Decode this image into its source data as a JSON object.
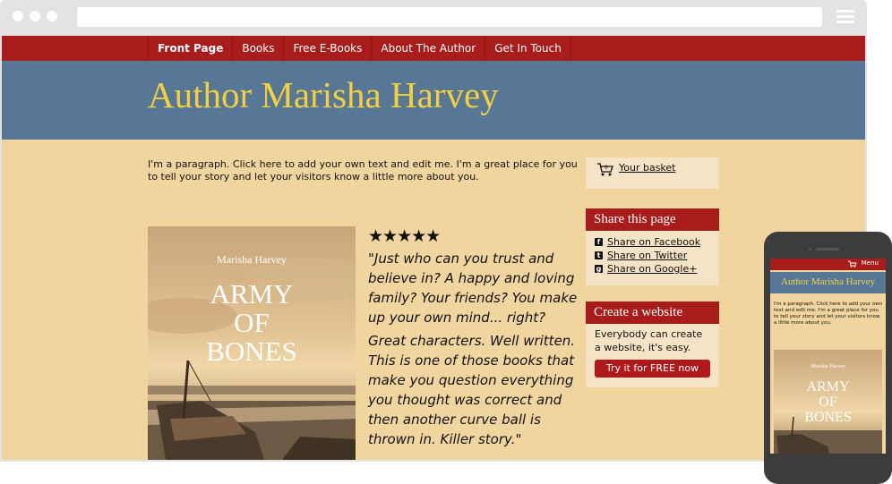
{
  "browser": {
    "url": ""
  },
  "nav": {
    "items": [
      {
        "label": "Front Page",
        "active": true
      },
      {
        "label": "Books"
      },
      {
        "label": "Free E-Books"
      },
      {
        "label": "About The Author"
      },
      {
        "label": "Get In Touch"
      }
    ]
  },
  "header": {
    "title": "Author Marisha Harvey"
  },
  "intro": {
    "text": "I'm a paragraph. Click here to add your own text and edit me. I'm a great place for you to tell your story and let your visitors know a little more about you."
  },
  "book": {
    "author": "Marisha Harvey",
    "title_lines": [
      "ARMY",
      "OF",
      "BONES"
    ]
  },
  "review": {
    "stars": "★★★★★",
    "rating": 5,
    "quote_1": "\"Just who can you trust and believe in? A happy and loving family? Your friends? You make up your own mind... right?",
    "quote_2": "Great characters. Well written. This is one of those books that make you question everything you thought was correct and then another curve ball is thrown in. Killer story.\""
  },
  "basket": {
    "label": "Your basket",
    "count": "0"
  },
  "share": {
    "heading": "Share this page",
    "items": [
      {
        "label": "Share on Facebook",
        "icon": "facebook-icon"
      },
      {
        "label": "Share on Twitter",
        "icon": "twitter-icon"
      },
      {
        "label": "Share on Google+",
        "icon": "google-plus-icon"
      }
    ]
  },
  "create": {
    "heading": "Create a website",
    "text": "Everybody can create a website, it's easy.",
    "button": "Try it for FREE now"
  },
  "mobile": {
    "menu": "Menu",
    "title": "Author Marisha Harvey",
    "text": "I'm a paragraph. Click here to add your own text and edit me. I'm a great place for you to tell your story and let your visitors know a little more about you.",
    "author": "Marisha Harvey",
    "title_lines": [
      "ARMY",
      "OF",
      "BONES"
    ]
  },
  "colors": {
    "nav": "#a81c1c",
    "header": "#567896",
    "title": "#f5cf3c",
    "page": "#f0d59f",
    "widget": "#f5e3c5"
  }
}
